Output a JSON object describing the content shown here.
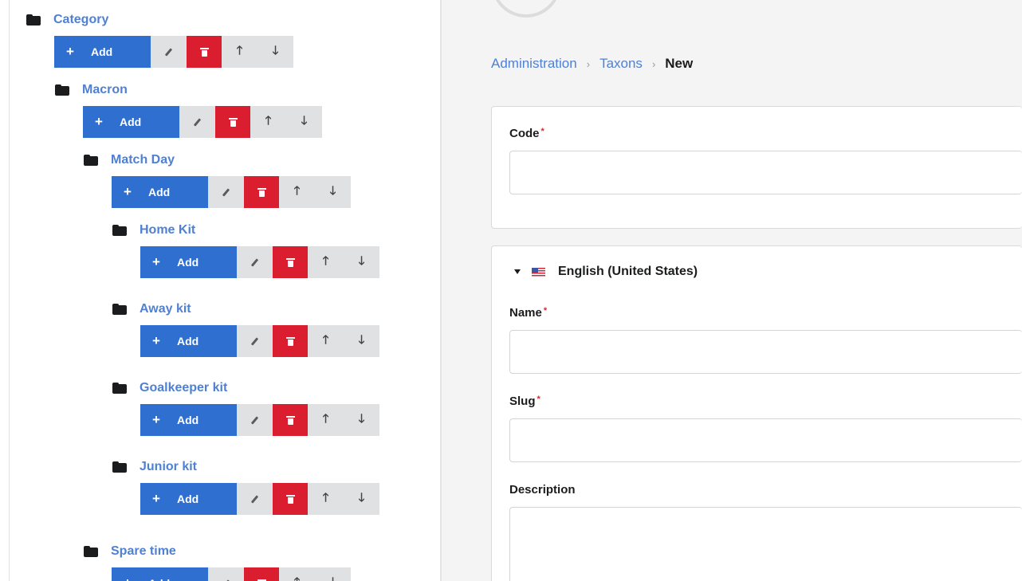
{
  "breadcrumb": {
    "item1": "Administration",
    "item2": "Taxons",
    "current": "New",
    "separator": "›"
  },
  "tree": {
    "add_label": "Add",
    "plus_symbol": "+",
    "up_symbol": "🡑",
    "down_symbol": "🡓",
    "nodes": [
      {
        "name": "Category"
      },
      {
        "name": "Macron"
      },
      {
        "name": "Match Day"
      },
      {
        "name": "Home Kit"
      },
      {
        "name": "Away kit"
      },
      {
        "name": "Goalkeeper kit"
      },
      {
        "name": "Junior kit"
      },
      {
        "name": "Spare time"
      }
    ]
  },
  "form": {
    "code_label": "Code",
    "required_mark": "*",
    "language": "English (United States)",
    "name_label": "Name",
    "slug_label": "Slug",
    "description_label": "Description"
  },
  "colors": {
    "primary": "#2f6fd0",
    "danger": "#db1e2f",
    "link": "#4f80d3",
    "required": "#db2828",
    "neutral_button": "#e0e1e2"
  }
}
